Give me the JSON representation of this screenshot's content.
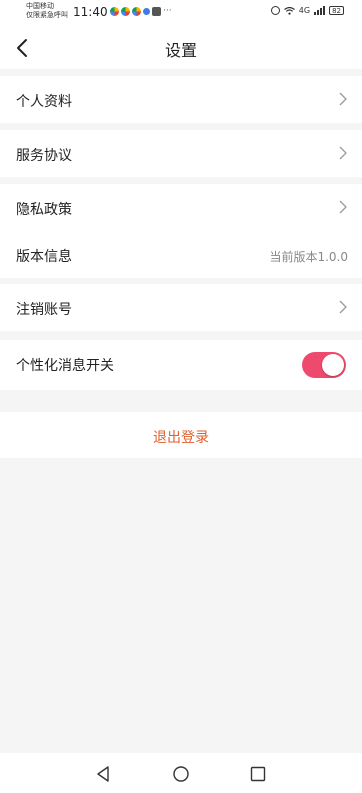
{
  "status_bar": {
    "carrier_line1": "中国移动",
    "carrier_line2": "仅限紧急呼叫",
    "time": "11:40",
    "more": "···",
    "network": "4G",
    "battery": "82"
  },
  "header": {
    "title": "设置"
  },
  "settings": {
    "profile": "个人资料",
    "service_agreement": "服务协议",
    "privacy_policy": "隐私政策",
    "version_label": "版本信息",
    "version_value": "当前版本1.0.0",
    "delete_account": "注销账号",
    "personalized_msg": "个性化消息开关",
    "personalized_msg_enabled": true
  },
  "logout": {
    "label": "退出登录",
    "color": "#e2602f"
  },
  "toggle_color": "#ee4a6e"
}
